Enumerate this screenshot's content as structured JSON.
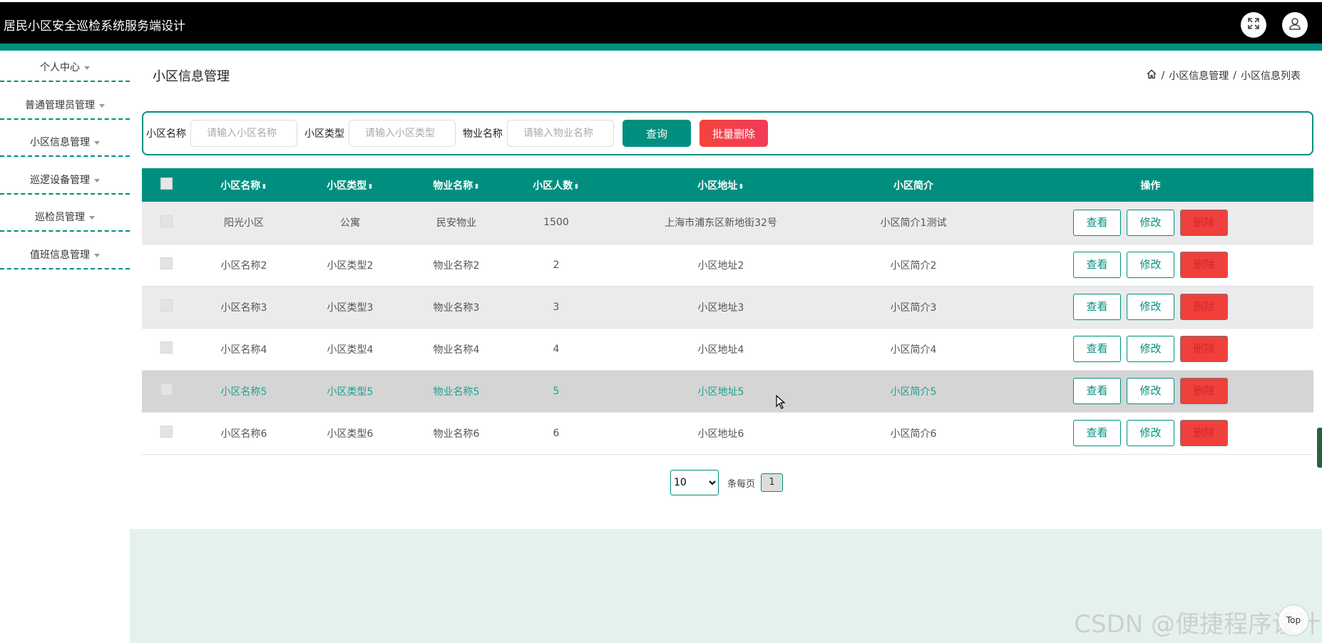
{
  "header": {
    "app_title": "居民小区安全巡检系统服务端设计",
    "fullscreen_icon": "fullscreen-icon",
    "user_icon": "user-icon"
  },
  "sidebar": {
    "items": [
      {
        "label": "个人中心"
      },
      {
        "label": "普通管理员管理"
      },
      {
        "label": "小区信息管理"
      },
      {
        "label": "巡逻设备管理"
      },
      {
        "label": "巡检员管理"
      },
      {
        "label": "值班信息管理"
      }
    ]
  },
  "main": {
    "page_title": "小区信息管理",
    "breadcrumb": {
      "home_icon": "home-icon",
      "sep1": "/",
      "item1": "小区信息管理",
      "sep2": "/",
      "item2": "小区信息列表"
    },
    "search": {
      "name_label": "小区名称",
      "name_placeholder": "请输入小区名称",
      "type_label": "小区类型",
      "type_placeholder": "请输入小区类型",
      "property_label": "物业名称",
      "property_placeholder": "请输入物业名称",
      "query_label": "查询",
      "batch_delete_label": "批量删除"
    },
    "table": {
      "columns": [
        "小区名称",
        "小区类型",
        "物业名称",
        "小区人数",
        "小区地址",
        "小区简介",
        "操作"
      ],
      "sort_glyph": "⬍",
      "rows": [
        {
          "name": "阳光小区",
          "type": "公寓",
          "property": "民安物业",
          "count": "1500",
          "address": "上海市浦东区新地街32号",
          "intro": "小区简介1测试"
        },
        {
          "name": "小区名称2",
          "type": "小区类型2",
          "property": "物业名称2",
          "count": "2",
          "address": "小区地址2",
          "intro": "小区简介2"
        },
        {
          "name": "小区名称3",
          "type": "小区类型3",
          "property": "物业名称3",
          "count": "3",
          "address": "小区地址3",
          "intro": "小区简介3"
        },
        {
          "name": "小区名称4",
          "type": "小区类型4",
          "property": "物业名称4",
          "count": "4",
          "address": "小区地址4",
          "intro": "小区简介4"
        },
        {
          "name": "小区名称5",
          "type": "小区类型5",
          "property": "物业名称5",
          "count": "5",
          "address": "小区地址5",
          "intro": "小区简介5"
        },
        {
          "name": "小区名称6",
          "type": "小区类型6",
          "property": "物业名称6",
          "count": "6",
          "address": "小区地址6",
          "intro": "小区简介6"
        }
      ],
      "actions": {
        "view": "查看",
        "edit": "修改",
        "delete": "删除"
      }
    },
    "pagination": {
      "page_size": "10",
      "page_size_options": [
        "10"
      ],
      "per_page_label": "条每页",
      "current_page": "1"
    }
  },
  "footer": {
    "watermark": "CSDN @便捷程序设计",
    "to_top_label": "Top"
  },
  "colors": {
    "primary": "#008f7f",
    "danger": "#f0403b",
    "header_bg": "#000000"
  }
}
